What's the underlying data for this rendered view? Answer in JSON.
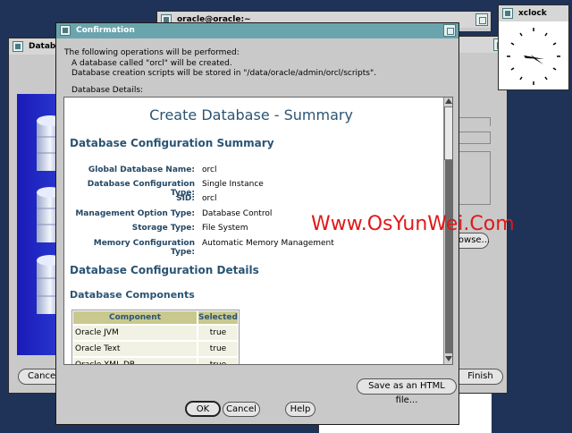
{
  "terminal": {
    "title": "oracle@oracle:~"
  },
  "xclock": {
    "title": "xclock"
  },
  "background_window": {
    "title_fragment": "Databa",
    "cancel_label": "Cancel",
    "finish_label": "Finish",
    "browse_label": "rowse..."
  },
  "dialog": {
    "title": "Confirmation",
    "intro": "The following operations will be performed:",
    "op1": "A database called \"orcl\" will be created.",
    "op2": "Database creation scripts will be stored in \"/data/oracle/admin/orcl/scripts\".",
    "details_label": "Database Details:",
    "save_html_label": "Save as an HTML file...",
    "ok_label": "OK",
    "cancel_label": "Cancel",
    "help_label": "Help"
  },
  "summary": {
    "heading": "Create Database - Summary",
    "config_summary_heading": "Database Configuration Summary",
    "fields": [
      {
        "label": "Global Database Name:",
        "value": "orcl"
      },
      {
        "label": "Database Configuration Type:",
        "value": "Single Instance"
      },
      {
        "label": "SID:",
        "value": "orcl"
      },
      {
        "label": "Management Option Type:",
        "value": "Database Control"
      },
      {
        "label": "Storage Type:",
        "value": "File System"
      },
      {
        "label": "Memory Configuration Type:",
        "value": "Automatic Memory Management"
      }
    ],
    "config_details_heading": "Database Configuration Details",
    "components_heading": "Database Components",
    "table": {
      "headers": [
        "Component",
        "Selected"
      ],
      "rows": [
        [
          "Oracle JVM",
          "true"
        ],
        [
          "Oracle Text",
          "true"
        ],
        [
          "Oracle XML DB",
          "true"
        ]
      ]
    }
  },
  "watermark": "Www.OsYunWei.Com",
  "colors": {
    "titlebar_active": "#6aa5ad",
    "heading": "#2b5473",
    "watermark": "#e01818",
    "desktop": "#1f3358"
  }
}
